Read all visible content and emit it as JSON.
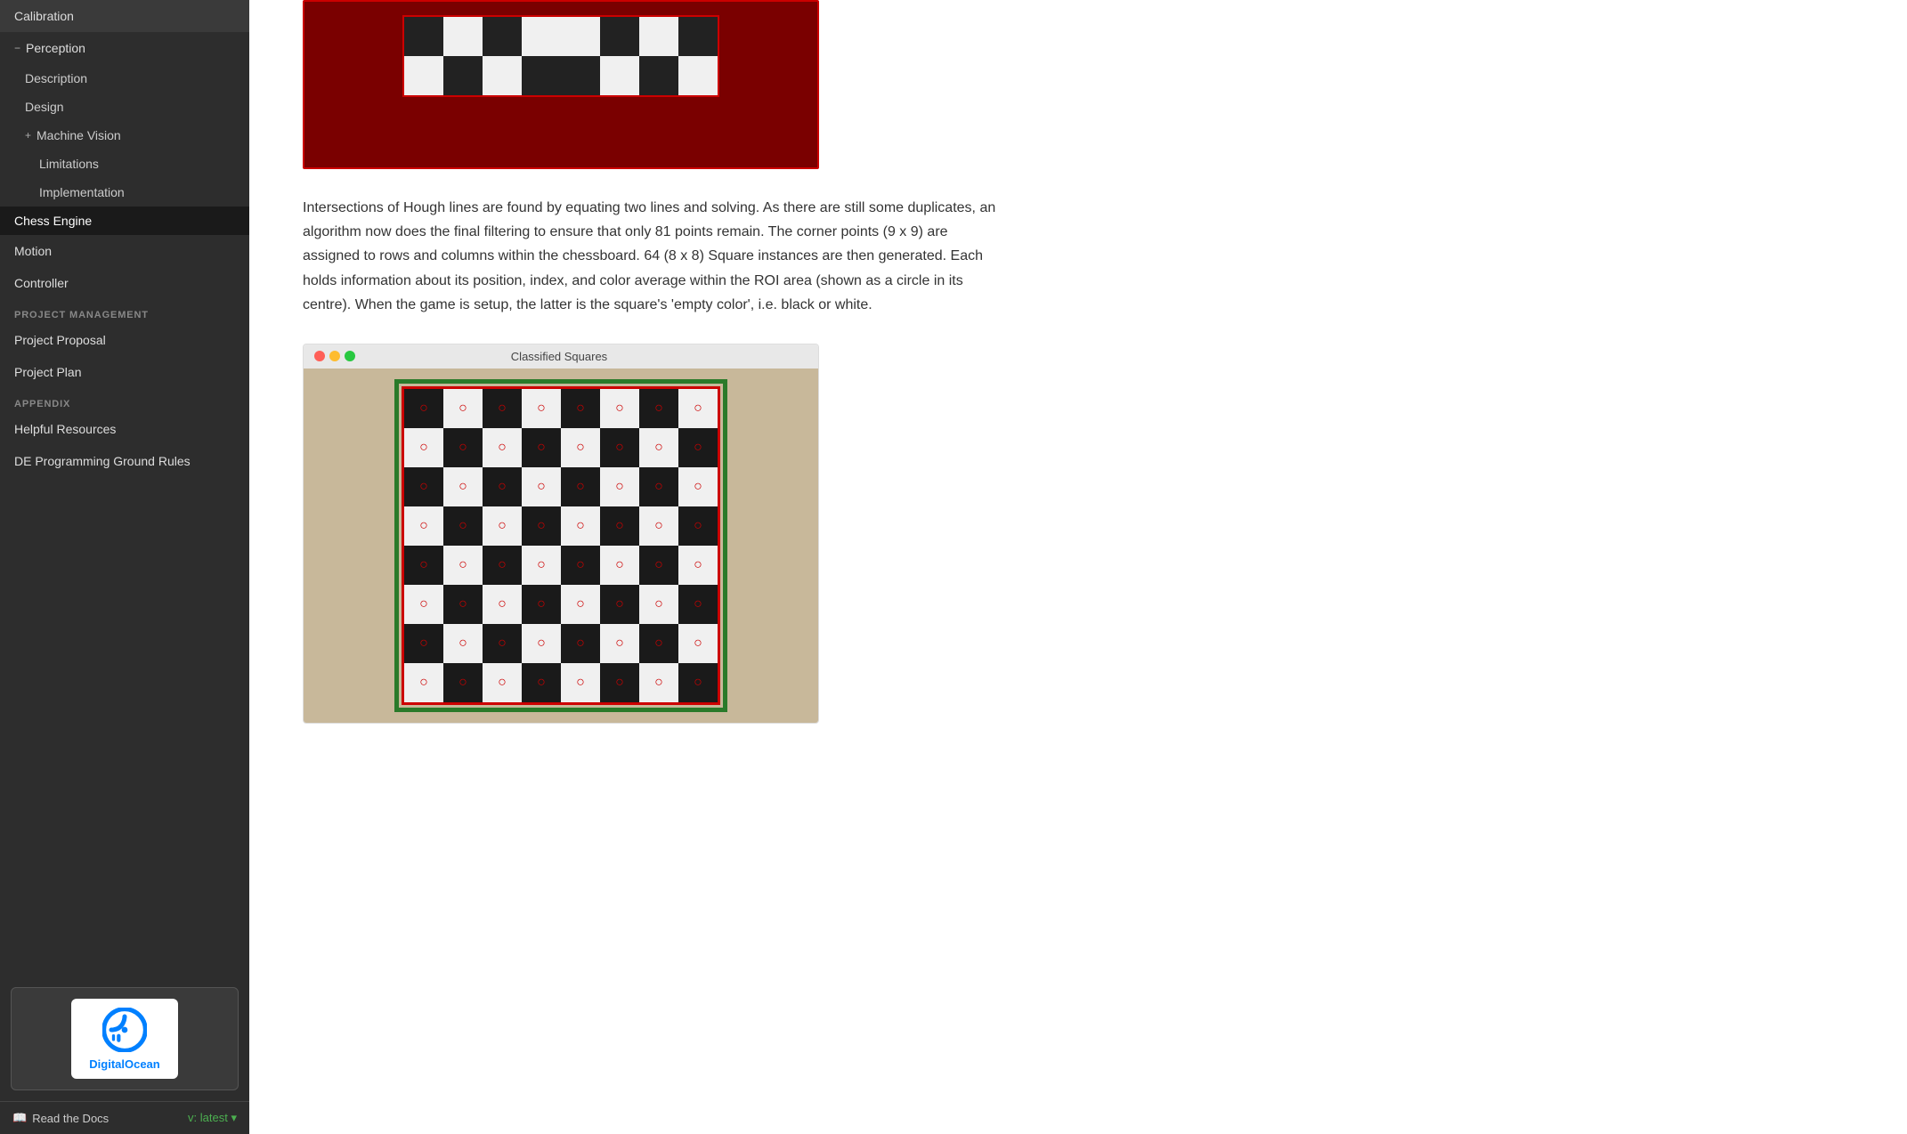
{
  "sidebar": {
    "items": [
      {
        "id": "calibration",
        "label": "Calibration",
        "level": 0,
        "active": false
      },
      {
        "id": "perception",
        "label": "Perception",
        "level": 0,
        "expanded": true,
        "hasToggle": true
      },
      {
        "id": "description",
        "label": "Description",
        "level": 1
      },
      {
        "id": "design",
        "label": "Design",
        "level": 1
      },
      {
        "id": "machine-vision",
        "label": "Machine Vision",
        "level": 1,
        "hasToggle": true
      },
      {
        "id": "limitations",
        "label": "Limitations",
        "level": 2
      },
      {
        "id": "implementation",
        "label": "Implementation",
        "level": 2
      },
      {
        "id": "chess-engine",
        "label": "Chess Engine",
        "level": 0,
        "active": true
      },
      {
        "id": "motion",
        "label": "Motion",
        "level": 0
      },
      {
        "id": "controller",
        "label": "Controller",
        "level": 0
      }
    ],
    "sections": [
      {
        "label": "PROJECT MANAGEMENT",
        "items": [
          {
            "id": "project-proposal",
            "label": "Project Proposal"
          },
          {
            "id": "project-plan",
            "label": "Project Plan"
          }
        ]
      },
      {
        "label": "APPENDIX",
        "items": [
          {
            "id": "helpful-resources",
            "label": "Helpful Resources"
          },
          {
            "id": "de-programming",
            "label": "DE Programming Ground Rules"
          }
        ]
      }
    ],
    "footer": {
      "read_docs_label": "Read the Docs",
      "version_label": "v: latest"
    }
  },
  "main": {
    "paragraph": "Intersections of Hough lines are found by equating two lines and solving. As there are still some duplicates, an algorithm now does the final filtering to ensure that only 81 points remain. The corner points (9 x 9) are assigned to rows and columns within the chessboard. 64 (8 x 8) Square instances are then generated. Each holds information about its position, index, and color average within the ROI area (shown as a circle in its centre). When the game is setup, the latter is the square's 'empty color', i.e. black or white.",
    "classified_title": "Classified Squares"
  },
  "icons": {
    "minus": "−",
    "plus": "+",
    "book": "📖",
    "chevron_down": "▾"
  }
}
